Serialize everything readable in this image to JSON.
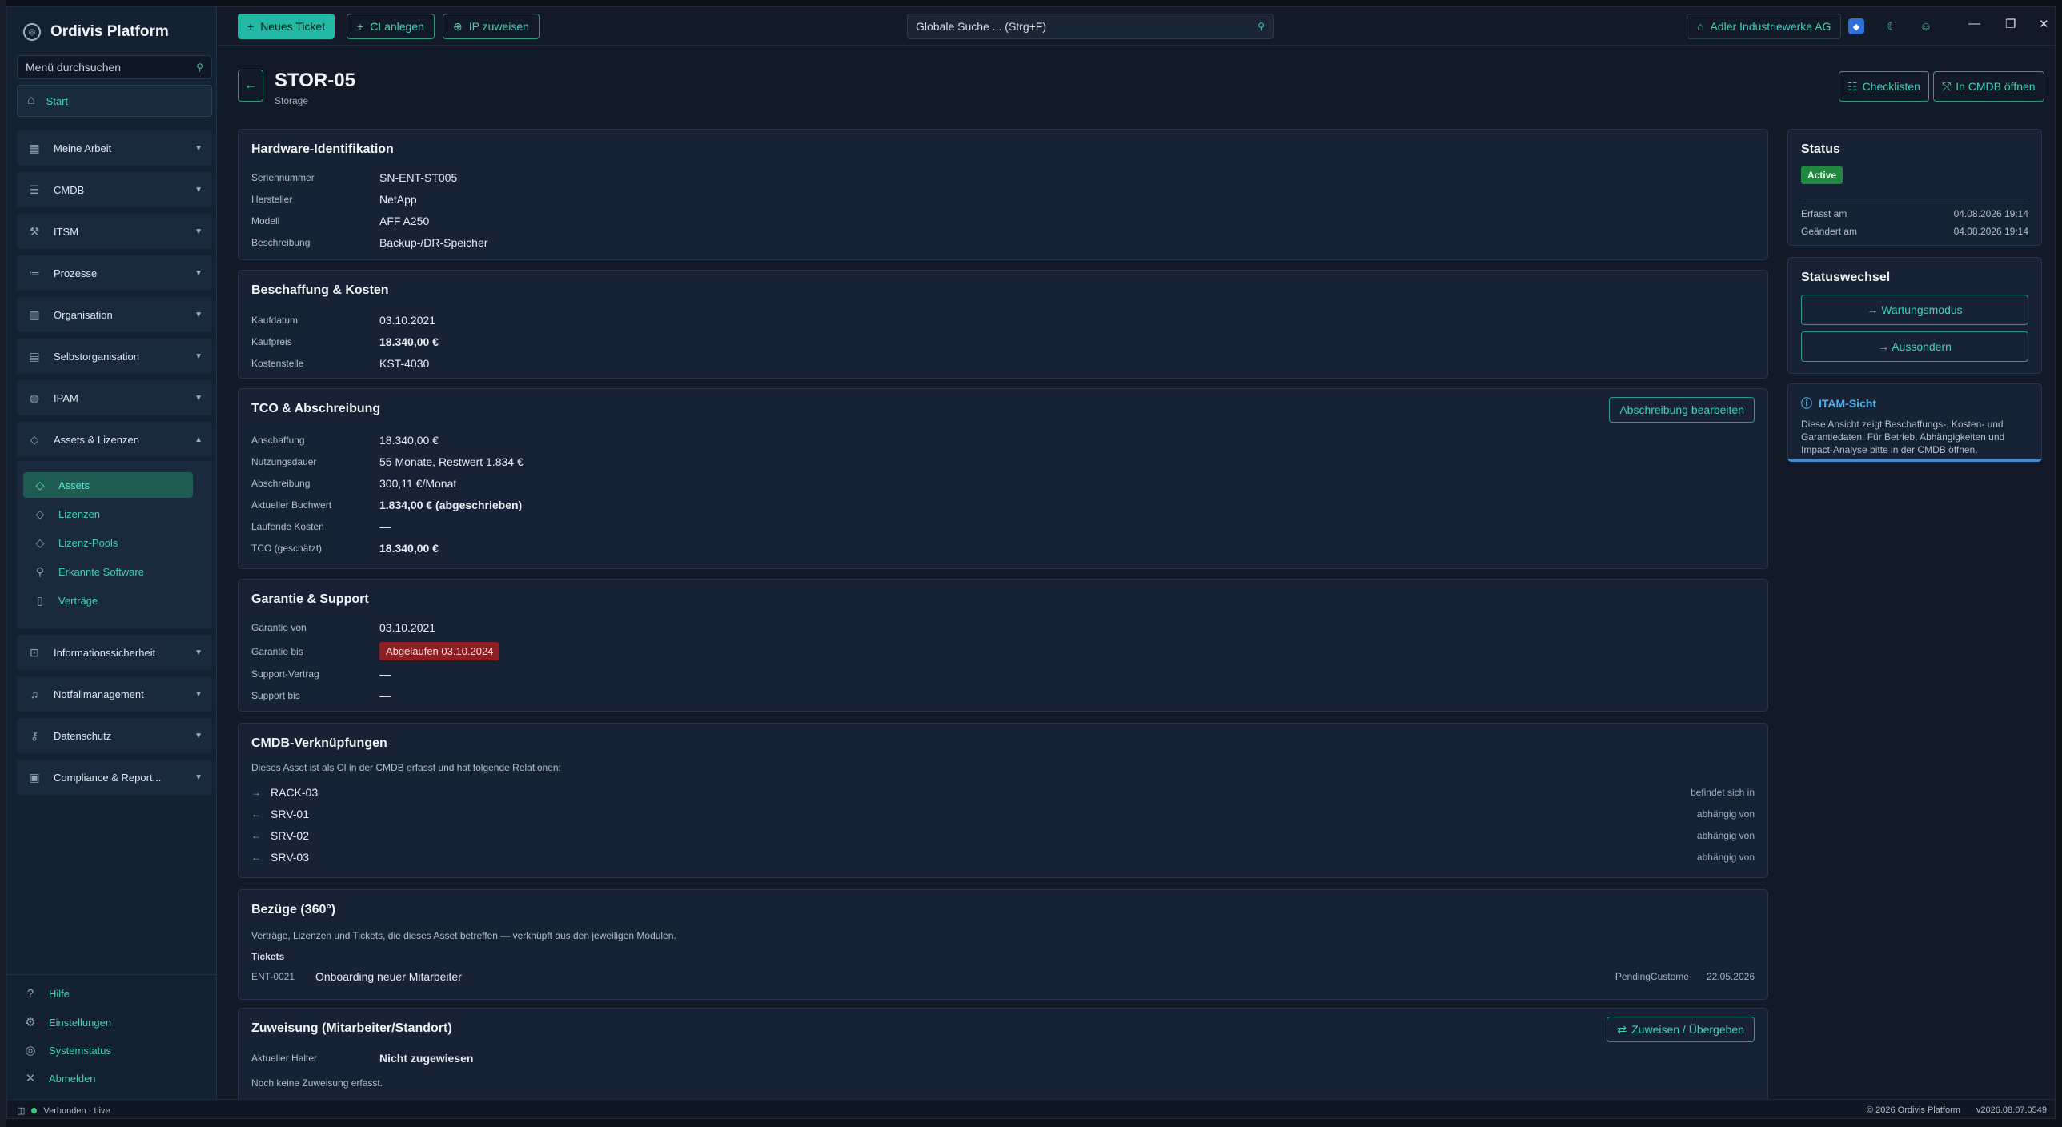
{
  "app": {
    "name": "Ordivis Platform"
  },
  "sidebar": {
    "search_placeholder": "Menü durchsuchen",
    "start": "Start",
    "groups": [
      {
        "label": "Meine Arbeit",
        "icon": "calendar-icon"
      },
      {
        "label": "CMDB",
        "icon": "list-icon"
      },
      {
        "label": "ITSM",
        "icon": "wrench-icon"
      },
      {
        "label": "Prozesse",
        "icon": "process-icon"
      },
      {
        "label": "Organisation",
        "icon": "building-icon"
      },
      {
        "label": "Selbstorganisation",
        "icon": "calendar-check-icon"
      },
      {
        "label": "IPAM",
        "icon": "network-icon"
      },
      {
        "label": "Assets & Lizenzen",
        "icon": "tag-icon"
      },
      {
        "label": "Informationssicherheit",
        "icon": "lock-icon"
      },
      {
        "label": "Notfallmanagement",
        "icon": "bell-icon"
      },
      {
        "label": "Datenschutz",
        "icon": "key-icon"
      },
      {
        "label": "Compliance & Report...",
        "icon": "report-icon"
      }
    ],
    "assets_items": [
      {
        "label": "Assets",
        "active": true
      },
      {
        "label": "Lizenzen"
      },
      {
        "label": "Lizenz-Pools"
      },
      {
        "label": "Erkannte Software"
      },
      {
        "label": "Verträge"
      }
    ],
    "bottom": {
      "help": "Hilfe",
      "settings": "Einstellungen",
      "status": "Systemstatus",
      "logout": "Abmelden"
    }
  },
  "topbar": {
    "new_ticket": "Neues Ticket",
    "create_ci": "CI anlegen",
    "assign_ip": "IP zuweisen",
    "search_placeholder": "Globale Suche ... (Strg+F)",
    "company": "Adler Industriewerke AG"
  },
  "page": {
    "title": "STOR-05",
    "subtitle": "Storage",
    "checklists_btn": "Checklisten",
    "open_cmdb_btn": "In CMDB öffnen"
  },
  "hardware": {
    "title": "Hardware-Identifikation",
    "rows": [
      {
        "k": "Seriennummer",
        "v": "SN-ENT-ST005"
      },
      {
        "k": "Hersteller",
        "v": "NetApp"
      },
      {
        "k": "Modell",
        "v": "AFF A250"
      },
      {
        "k": "Beschreibung",
        "v": "Backup-/DR-Speicher"
      }
    ]
  },
  "procurement": {
    "title": "Beschaffung & Kosten",
    "rows": [
      {
        "k": "Kaufdatum",
        "v": "03.10.2021"
      },
      {
        "k": "Kaufpreis",
        "v": "18.340,00 €"
      },
      {
        "k": "Kostenstelle",
        "v": "KST-4030"
      }
    ]
  },
  "tco": {
    "title": "TCO & Abschreibung",
    "edit_btn": "Abschreibung bearbeiten",
    "rows": [
      {
        "k": "Anschaffung",
        "v": "18.340,00 €"
      },
      {
        "k": "Nutzungsdauer",
        "v": "55 Monate, Restwert 1.834 €"
      },
      {
        "k": "Abschreibung",
        "v": "300,11 €/Monat"
      },
      {
        "k": "Aktueller Buchwert",
        "v": "1.834,00 € (abgeschrieben)"
      },
      {
        "k": "Laufende Kosten",
        "v": "—"
      },
      {
        "k": "TCO (geschätzt)",
        "v": "18.340,00 €"
      }
    ]
  },
  "warranty": {
    "title": "Garantie & Support",
    "rows": [
      {
        "k": "Garantie von",
        "v": "03.10.2021"
      },
      {
        "k": "Garantie bis",
        "v": "Abgelaufen 03.10.2024"
      },
      {
        "k": "Support-Vertrag",
        "v": "—"
      },
      {
        "k": "Support bis",
        "v": "—"
      }
    ]
  },
  "cmdb": {
    "title": "CMDB-Verknüpfungen",
    "desc": "Dieses Asset ist als CI in der CMDB erfasst und hat folgende Relationen:",
    "relations": [
      {
        "arrow": "→",
        "name": "RACK-03",
        "type": "befindet sich in"
      },
      {
        "arrow": "←",
        "name": "SRV-01",
        "type": "abhängig von"
      },
      {
        "arrow": "←",
        "name": "SRV-02",
        "type": "abhängig von"
      },
      {
        "arrow": "←",
        "name": "SRV-03",
        "type": "abhängig von"
      }
    ]
  },
  "refs": {
    "title": "Bezüge (360°)",
    "desc": "Verträge, Lizenzen und Tickets, die dieses Asset betreffen — verknüpft aus den jeweiligen Modulen.",
    "tickets_label": "Tickets",
    "ticket": {
      "id": "ENT-0021",
      "title": "Onboarding neuer Mitarbeiter",
      "status": "PendingCustome",
      "date": "22.05.2026"
    }
  },
  "assignment": {
    "title": "Zuweisung (Mitarbeiter/Standort)",
    "btn": "Zuweisen / Übergeben",
    "holder_label": "Aktueller Halter",
    "holder_value": "Nicht zugewiesen",
    "note": "Noch keine Zuweisung erfasst."
  },
  "status_card": {
    "title": "Status",
    "badge": "Active",
    "created_label": "Erfasst am",
    "created_value": "04.08.2026 19:14",
    "changed_label": "Geändert am",
    "changed_value": "04.08.2026 19:14"
  },
  "status_change": {
    "title": "Statuswechsel",
    "btn1": "→ Wartungsmodus",
    "btn2": "→ Aussondern"
  },
  "itam": {
    "title": "ITAM-Sicht",
    "desc": "Diese Ansicht zeigt Beschaffungs-, Kosten- und Garantiedaten. Für Betrieb, Abhängigkeiten und Impact-Analyse bitte in der CMDB öffnen."
  },
  "statusbar": {
    "connection": "Verbunden · Live",
    "copyright": "© 2026 Ordivis Platform",
    "version": "v2026.08.07.0549"
  },
  "colors": {
    "accent": "#22b8a5",
    "bg": "#111a26",
    "card": "#172334",
    "danger": "#8c1f24",
    "success": "#1f8a3f"
  }
}
